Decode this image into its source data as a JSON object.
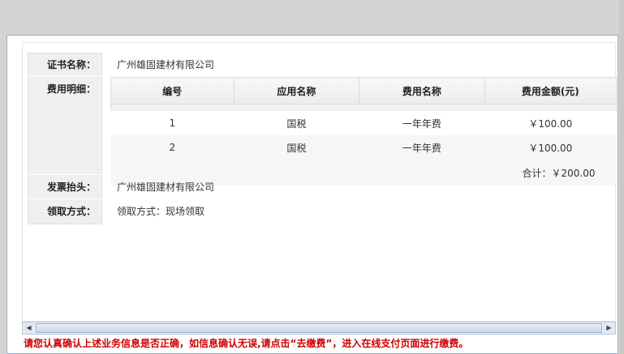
{
  "certificate": {
    "label": "证书名称：",
    "value": "广州雄固建材有限公司"
  },
  "fee_details": {
    "label": "费用明细：",
    "headers": [
      "编号",
      "应用名称",
      "费用名称",
      "费用金额(元)"
    ],
    "rows": [
      [
        "1",
        "国税",
        "一年年费",
        "￥100.00"
      ],
      [
        "2",
        "国税",
        "一年年费",
        "￥100.00"
      ]
    ],
    "total": "合计：￥200.00"
  },
  "invoice": {
    "label": "发票抬头：",
    "value": "广州雄固建材有限公司"
  },
  "pickup": {
    "label": "领取方式：",
    "value": "领取方式：现场领取"
  },
  "notice": "请您认真确认上述业务信息是否正确，如信息确认无误,请点击“去缴费”，进入在线支付页面进行缴费。",
  "colors": {
    "notice": "#cc0000",
    "panel_border": "#9bb0c8"
  }
}
